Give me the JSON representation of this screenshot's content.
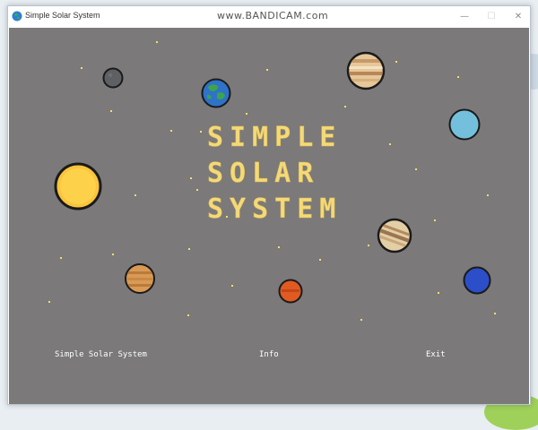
{
  "window": {
    "title": "Simple Solar System",
    "minimize_icon": "minimize-icon",
    "maximize_icon": "maximize-icon",
    "close_icon": "close-icon"
  },
  "watermark": "www.BANDICAM.com",
  "game": {
    "title_lines": [
      "SIMPLE",
      "SOLAR",
      "SYSTEM"
    ],
    "title_color": "#f4d97a",
    "background_color": "#7b7979",
    "menu": {
      "start_label": "Simple Solar System",
      "info_label": "Info",
      "exit_label": "Exit"
    },
    "planets": [
      "sun",
      "mercury",
      "venus",
      "earth",
      "mars",
      "jupiter",
      "saturn",
      "uranus",
      "neptune"
    ]
  }
}
